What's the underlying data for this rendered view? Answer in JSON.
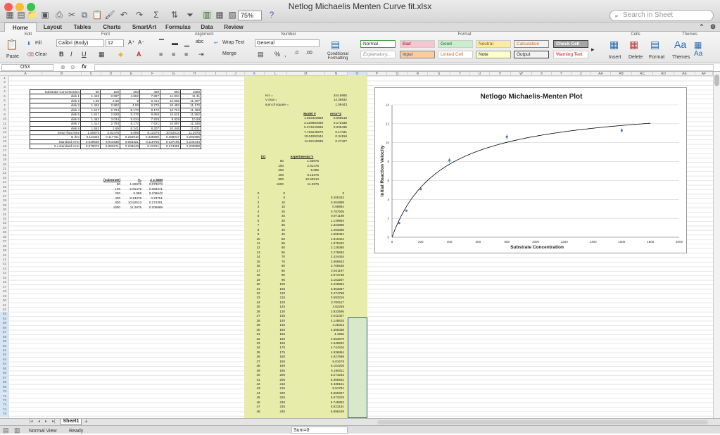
{
  "window": {
    "title": "Netlog Michaelis Menten Curve fit.xlsx",
    "search_placeholder": "Search in Sheet",
    "zoom": "75%"
  },
  "tabs": [
    "Home",
    "Layout",
    "Tables",
    "Charts",
    "SmartArt",
    "Formulas",
    "Data",
    "Review"
  ],
  "ribbon": {
    "groups": {
      "edit": "Edit",
      "font": "Font",
      "alignment": "Alignment",
      "number": "Number",
      "format": "Format",
      "cells": "Cells",
      "themes": "Themes"
    },
    "fill": "Fill",
    "clear": "Clear",
    "paste": "Paste",
    "font_name": "Calibri (Body)",
    "font_size": "12",
    "wrap_text": "Wrap Text",
    "merge": "Merge",
    "number_format": "General",
    "conditional_formatting": "Conditional Formatting",
    "styles": [
      {
        "label": "Normal",
        "bg": "#ffffff",
        "fg": "#222222",
        "border": "#4a9a4a"
      },
      {
        "label": "Bad",
        "bg": "#f4c7ce",
        "fg": "#9c1c2c",
        "border": "#cccccc"
      },
      {
        "label": "Good",
        "bg": "#c8eece",
        "fg": "#1e6a28",
        "border": "#cccccc"
      },
      {
        "label": "Neutral",
        "bg": "#fdeba3",
        "fg": "#8a5a10",
        "border": "#cccccc"
      },
      {
        "label": "Calculation",
        "bg": "#f2f2f2",
        "fg": "#d8681c",
        "border": "#888888"
      },
      {
        "label": "Check Cell",
        "bg": "#a5a5a5",
        "fg": "#ffffff",
        "border": "#444444"
      },
      {
        "label": "Explanatory...",
        "bg": "#ffffff",
        "fg": "#888888",
        "border": "#cccccc"
      },
      {
        "label": "Input",
        "bg": "#fbcc9f",
        "fg": "#3a3a8a",
        "border": "#888888"
      },
      {
        "label": "Linked Cell",
        "bg": "#ffffff",
        "fg": "#d8681c",
        "border": "#cccccc"
      },
      {
        "label": "Note",
        "bg": "#ffffcc",
        "fg": "#222222",
        "border": "#999999"
      },
      {
        "label": "Output",
        "bg": "#f2f2f2",
        "fg": "#222222",
        "border": "#444444"
      },
      {
        "label": "Warning Text",
        "bg": "#ffffff",
        "fg": "#d01010",
        "border": "#cccccc"
      }
    ],
    "insert": "Insert",
    "delete": "Delete",
    "format_btn": "Format",
    "themes_btn": "Themes"
  },
  "formula_bar": {
    "name_box": "O53",
    "fx": "fx"
  },
  "columns": [
    "A",
    "B",
    "C",
    "D",
    "E",
    "F",
    "G",
    "H",
    "I",
    "J",
    "K",
    "L",
    "M",
    "N",
    "O",
    "P",
    "Q",
    "R",
    "S",
    "T",
    "U",
    "V",
    "W",
    "X",
    "Y",
    "Z",
    "AA",
    "AB",
    "AC",
    "AD",
    "AE",
    "AF"
  ],
  "disk_table": {
    "header": [
      "Substrate Concentration",
      "50",
      "100",
      "200",
      "400",
      "800",
      "1600"
    ],
    "rows": [
      [
        "disk 1",
        "1.448",
        "2.897",
        "4.862",
        "7.897",
        "11.034",
        "11.31"
      ],
      [
        "disk 2",
        "1.69",
        "2.69",
        "5",
        "8.414",
        "10.966",
        "11.207"
      ],
      [
        "disk 3",
        "1.345",
        "2.862",
        "4.93",
        "8.276",
        "10.483",
        "11.172"
      ],
      [
        "disk 4",
        "1.517",
        "2.724",
        "5.172",
        "8.172",
        "10.724",
        "11.483"
      ],
      [
        "disk 5",
        "1.621",
        "2.828",
        "5.276",
        "8.655",
        "10.621",
        "11.552"
      ],
      [
        "disk 6",
        "1.482",
        "3.034",
        "5.034",
        "7.828",
        "9.828",
        "10.69"
      ],
      [
        "disk 7",
        "1.414",
        "2.793",
        "5.172",
        "7.621",
        "10.897",
        "11.345"
      ],
      [
        "disk 8",
        "1.552",
        "2.69",
        "5.241",
        "8.207",
        "10.448",
        "11.621"
      ],
      [
        "mean float time",
        "1.50875",
        "2.81475",
        "5.086",
        "8.13375",
        "10.62513",
        "11.2975"
      ],
      [
        "st dev",
        "0.111826",
        "0.117761",
        "0.150816",
        "0.335685",
        "0.388047",
        "0.292585"
      ],
      [
        "Standard error",
        "0.039536",
        "0.041636",
        "0.053321",
        "0.118755",
        "0.137195",
        "0.103444"
      ],
      [
        "2 x standard error",
        "0.079073",
        "0.083271",
        "0.106643",
        "0.23751",
        "0.274391",
        "0.206889"
      ]
    ]
  },
  "summary_table": {
    "header": [
      "[substrate]",
      "V₀",
      "2 x SEM"
    ],
    "rows": [
      [
        "50",
        "1.50875",
        "0.079073"
      ],
      [
        "100",
        "2.81475",
        "0.083271"
      ],
      [
        "200",
        "5.086",
        "0.106643"
      ],
      [
        "400",
        "8.13375",
        "0.23751"
      ],
      [
        "800",
        "10.62513",
        "0.274391"
      ],
      [
        "1600",
        "11.2975",
        "0.206889"
      ]
    ]
  },
  "params": {
    "rows": [
      [
        "Km =",
        "344.8865"
      ],
      [
        "V max =",
        "14.36932"
      ],
      [
        "sum of square =",
        "1.09443"
      ]
    ]
  },
  "model_table": {
    "header": [
      "Model V",
      "error^2"
    ],
    "rows": [
      [
        "1.819423859",
        "0.096518"
      ],
      [
        "3.229884098",
        "0.172336"
      ],
      [
        "5.274243696",
        "0.035435"
      ],
      [
        "7.716245676",
        "0.17431"
      ],
      [
        "10.04093344",
        "0.34156"
      ],
      [
        "11.82120838",
        "0.27427"
      ]
    ]
  },
  "experimental_table": {
    "header": [
      "[S]",
      "experimental V"
    ],
    "rows": [
      [
        "50",
        "1.50875"
      ],
      [
        "100",
        "2.81475"
      ],
      [
        "200",
        "5.086"
      ],
      [
        "400",
        "8.13375"
      ],
      [
        "800",
        "10.62513"
      ],
      [
        "1600",
        "11.2975"
      ]
    ]
  },
  "curve_table": {
    "rows": [
      [
        "0",
        "0",
        "0"
      ],
      [
        "1",
        "5",
        "0.205343"
      ],
      [
        "2",
        "10",
        "0.404899"
      ],
      [
        "3",
        "15",
        "0.59891"
      ],
      [
        "4",
        "20",
        "0.787605"
      ],
      [
        "5",
        "25",
        "0.971198"
      ],
      [
        "6",
        "30",
        "1.149894"
      ],
      [
        "7",
        "35",
        "1.323885"
      ],
      [
        "8",
        "40",
        "1.493356"
      ],
      [
        "9",
        "45",
        "1.658481"
      ],
      [
        "10",
        "50",
        "1.819424"
      ],
      [
        "11",
        "55",
        "1.976342"
      ],
      [
        "12",
        "60",
        "2.129385"
      ],
      [
        "13",
        "65",
        "2.278693"
      ],
      [
        "14",
        "70",
        "2.424404"
      ],
      [
        "15",
        "75",
        "2.566643"
      ],
      [
        "16",
        "80",
        "2.705535"
      ],
      [
        "17",
        "85",
        "2.841197"
      ],
      [
        "18",
        "90",
        "2.973738",
        "x"
      ],
      [
        "19",
        "95",
        "3.103267"
      ],
      [
        "20",
        "100",
        "3.229884"
      ],
      [
        "21",
        "105",
        "3.353687"
      ],
      [
        "22",
        "110",
        "3.474768"
      ],
      [
        "23",
        "115",
        "3.593216"
      ],
      [
        "24",
        "120",
        "3.709117"
      ],
      [
        "25",
        "125",
        "3.82255"
      ],
      [
        "26",
        "130",
        "3.933595"
      ],
      [
        "27",
        "135",
        "4.042327"
      ],
      [
        "28",
        "140",
        "4.148815"
      ],
      [
        "29",
        "145",
        "4.25313"
      ],
      [
        "30",
        "150",
        "4.355338"
      ],
      [
        "31",
        "155",
        "4.4555"
      ],
      [
        "32",
        "160",
        "4.553679"
      ],
      [
        "33",
        "165",
        "4.649932"
      ],
      [
        "34",
        "170",
        "4.744316"
      ],
      [
        "35",
        "175",
        "4.836884"
      ],
      [
        "36",
        "180",
        "4.927689"
      ],
      [
        "37",
        "185",
        "5.01678"
      ],
      [
        "38",
        "190",
        "5.104205"
      ],
      [
        "39",
        "195",
        "5.190011"
      ],
      [
        "40",
        "200",
        "5.274243"
      ],
      [
        "41",
        "205",
        "5.356942"
      ],
      [
        "42",
        "210",
        "5.438151"
      ],
      [
        "43",
        "215",
        "5.51791"
      ],
      [
        "44",
        "220",
        "5.596257"
      ],
      [
        "45",
        "225",
        "5.673229"
      ],
      [
        "46",
        "230",
        "5.748862"
      ],
      [
        "47",
        "235",
        "5.823191"
      ],
      [
        "48",
        "240",
        "5.896249"
      ]
    ]
  },
  "chart_data": {
    "type": "scatter",
    "title": "Netlogo Michaelis-Menten Plot",
    "xlabel": "Substrate Concentration",
    "ylabel": "Initial Reaction Velocity",
    "xlim": [
      0,
      2000
    ],
    "ylim": [
      0,
      14
    ],
    "xticks": [
      "0",
      "200",
      "400",
      "600",
      "800",
      "1000",
      "1200",
      "1400",
      "1600",
      "1800",
      "2000"
    ],
    "yticks": [
      "0",
      "2",
      "4",
      "6",
      "8",
      "10",
      "12",
      "14"
    ],
    "grid": true,
    "series": [
      {
        "x": [
          50,
          100,
          200,
          400,
          800,
          1600
        ],
        "y": [
          1.50875,
          2.81475,
          5.086,
          8.13375,
          10.62513,
          11.2975
        ],
        "err": [
          0.079073,
          0.083271,
          0.106643,
          0.23751,
          0.274391,
          0.206889
        ],
        "color": "#4a7ebb"
      }
    ],
    "fit": {
      "vmax": 14.36932,
      "km": 344.8865,
      "x_end": 1800,
      "color": "#000000"
    }
  },
  "sheet_tab": "Sheet1",
  "status": {
    "view": "Normal View",
    "ready": "Ready",
    "sum": "Sum=0"
  }
}
